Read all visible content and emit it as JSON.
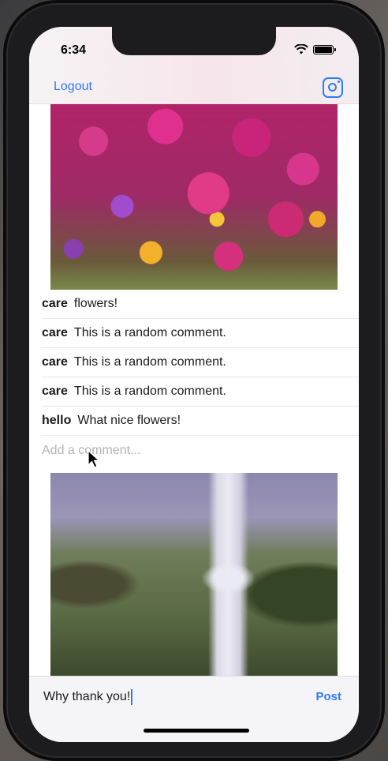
{
  "status_bar": {
    "time": "6:34"
  },
  "nav": {
    "logout_label": "Logout",
    "camera_icon": "camera-icon"
  },
  "posts": [
    {
      "comments": [
        {
          "user": "care",
          "text": "flowers!"
        },
        {
          "user": "care",
          "text": "This is a random comment."
        },
        {
          "user": "care",
          "text": "This is a random comment."
        },
        {
          "user": "care",
          "text": "This is a random comment."
        },
        {
          "user": "hello",
          "text": "What nice flowers!"
        }
      ],
      "add_comment_placeholder": "Add a comment..."
    }
  ],
  "composer": {
    "value": "Why thank you!",
    "post_label": "Post"
  },
  "colors": {
    "accent": "#2f7cf6"
  }
}
